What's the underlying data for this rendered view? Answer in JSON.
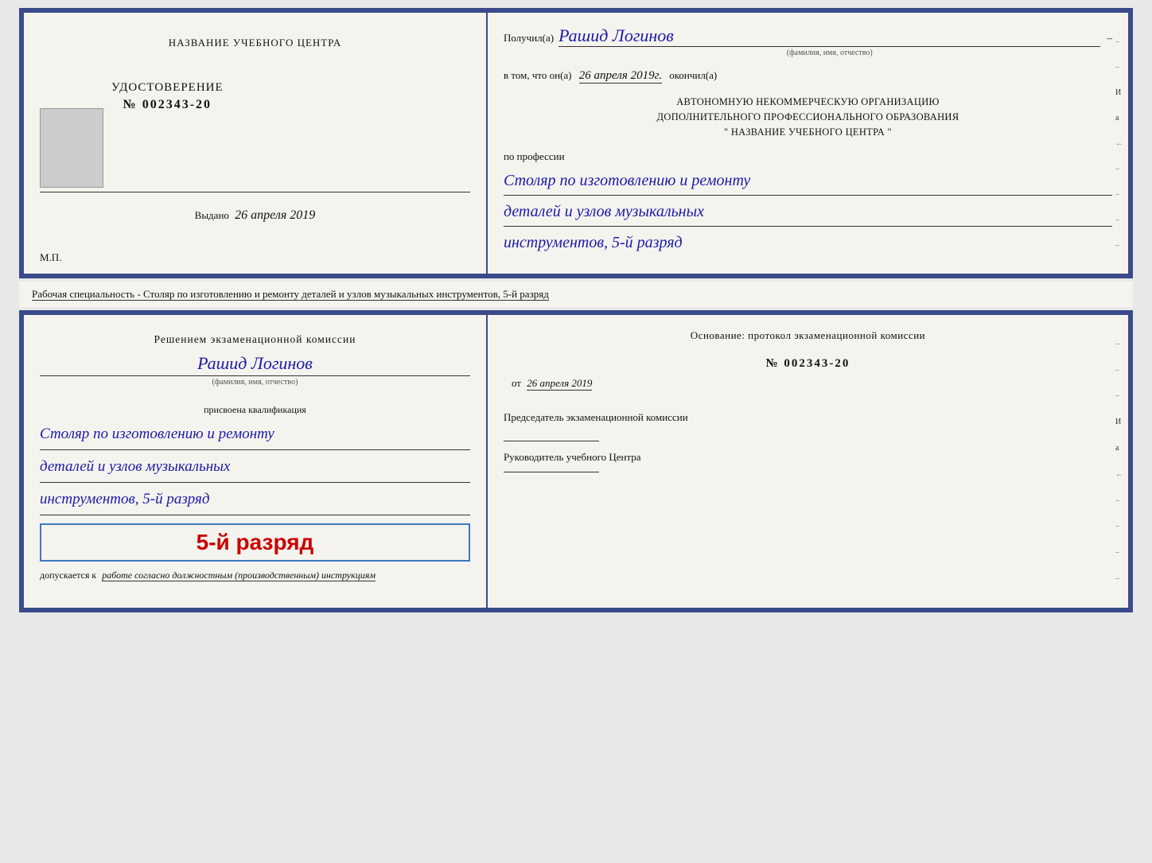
{
  "page": {
    "background": "#e8e8e8"
  },
  "doc_top": {
    "left": {
      "center_title": "НАЗВАНИЕ УЧЕБНОГО ЦЕНТРА",
      "cert_type": "УДОСТОВЕРЕНИЕ",
      "cert_number": "№ 002343-20",
      "vidano_label": "Выдано",
      "vidano_date": "26 апреля 2019",
      "mp_label": "М.П."
    },
    "right": {
      "poluchil_label": "Получил(а)",
      "fio_hand": "Рашид Логинов",
      "fio_subtitle": "(фамилия, имя, отчество)",
      "vtom_prefix": "в том, что он(а)",
      "vtom_date_hand": "26 апреля 2019г.",
      "okonchil_label": "окончил(а)",
      "autonomous_line1": "АВТОНОМНУЮ НЕКОММЕРЧЕСКУЮ ОРГАНИЗАЦИЮ",
      "autonomous_line2": "ДОПОЛНИТЕЛЬНОГО ПРОФЕССИОНАЛЬНОГО ОБРАЗОВАНИЯ",
      "autonomous_line3": "\"  НАЗВАНИЕ УЧЕБНОГО ЦЕНТРА  \"",
      "po_professii_label": "по профессии",
      "profession_line1": "Столяр по изготовлению и ремонту",
      "profession_line2": "деталей и узлов музыкальных",
      "profession_line3": "инструментов, 5-й разряд"
    }
  },
  "middle_text": "Рабочая специальность - Столяр по изготовлению и ремонту деталей и узлов музыкальных инструментов, 5-й разряд",
  "doc_bottom": {
    "left": {
      "resheniem_label": "Решением экзаменационной комиссии",
      "fio_hand": "Рашид Логинов",
      "fio_subtitle": "(фамилия, имя, отчество)",
      "prisvoena_label": "присвоена квалификация",
      "qualification_line1": "Столяр по изготовлению и ремонту",
      "qualification_line2": "деталей и узлов музыкальных",
      "qualification_line3": "инструментов, 5-й разряд",
      "big_rank": "5-й разряд",
      "dopuskaetsya_label": "допускается к",
      "dopuskaetsya_text": "работе согласно должностным (производственным) инструкциям"
    },
    "right": {
      "osnovanie_label": "Основание: протокол экзаменационной комиссии",
      "protocol_number": "№  002343-20",
      "ot_label": "от",
      "ot_date": "26 апреля 2019",
      "chairman_label": "Председатель экзаменационной комиссии",
      "ruk_label": "Руководитель учебного Центра"
    }
  }
}
